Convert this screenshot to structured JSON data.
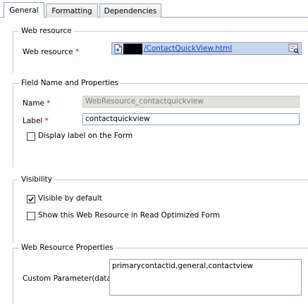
{
  "tabs": [
    {
      "label": "General",
      "active": true
    },
    {
      "label": "Formatting",
      "active": false
    },
    {
      "label": "Dependencies",
      "active": false
    }
  ],
  "web_resource_section": {
    "title": "Web resource",
    "field_label": "Web resource",
    "required_mark": "*",
    "value": "/ContactQuickView.html",
    "icon": "document-icon",
    "lookup_icon": "lookup-icon"
  },
  "field_section": {
    "title": "Field Name and Properties",
    "name_label": "Name",
    "name_value": "WebResource_contactquickview",
    "label_label": "Label",
    "label_value": "contactquickview",
    "required_mark": "*",
    "display_label_text": "Display label on the Form",
    "display_label_checked": false
  },
  "visibility_section": {
    "title": "Visibility",
    "visible_default_text": "Visible by default",
    "visible_default_checked": true,
    "read_optimized_text": "Show this Web Resource in Read Optimized Form",
    "read_optimized_checked": false
  },
  "properties_section": {
    "title": "Web Resource Properties",
    "custom_param_label": "Custom Parameter(data)",
    "custom_param_value": "primarycontactid,general,contactview"
  },
  "colors": {
    "accent_blue": "#1f3fbf",
    "lookup_bg": "#c6d8f0",
    "required_red": "#d00000",
    "border": "#8f9fb8"
  }
}
